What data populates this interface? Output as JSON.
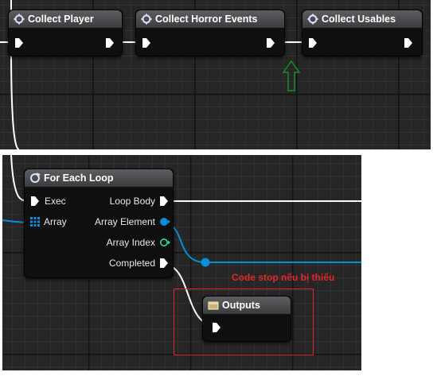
{
  "top_nodes": {
    "collect_player": {
      "title": "Collect Player"
    },
    "collect_horror_events": {
      "title": "Collect Horror Events"
    },
    "collect_usables": {
      "title": "Collect Usables"
    }
  },
  "for_each_loop": {
    "title": "For Each Loop",
    "inputs": {
      "exec": "Exec",
      "array": "Array"
    },
    "outputs": {
      "loop_body": "Loop Body",
      "array_element": "Array Element",
      "array_index": "Array Index",
      "completed": "Completed"
    }
  },
  "outputs_node": {
    "title": "Outputs"
  },
  "annotation": {
    "text": "Code stop nếu bị thiếu",
    "color": "#e3282a"
  },
  "colors": {
    "exec_wire": "#ffffff",
    "data_wire": "#0a8ed9",
    "int_pin": "#1fe0a3",
    "arrow": "#1a8a2a"
  }
}
